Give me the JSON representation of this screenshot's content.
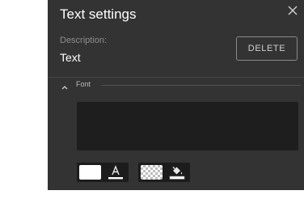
{
  "dialog": {
    "title": "Text settings",
    "close_icon": "close-icon"
  },
  "description": {
    "label": "Description:",
    "value": "Text"
  },
  "delete_button": {
    "label": "DELETE"
  },
  "font_section": {
    "label": "Font",
    "expanded": true,
    "toggle_icon": "chevron-up-icon"
  },
  "text_input": {
    "value": ""
  },
  "text_color": {
    "color": "#ffffff",
    "icon": "text-color-icon"
  },
  "background_color": {
    "color": "transparent",
    "icon": "fill-color-icon"
  }
}
